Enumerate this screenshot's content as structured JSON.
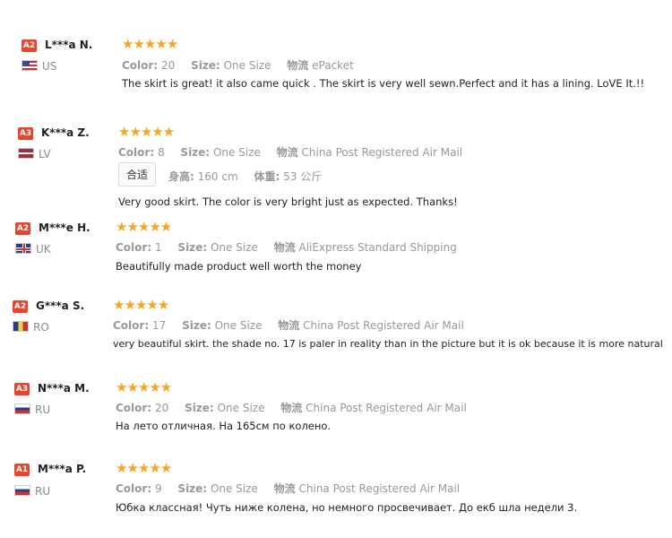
{
  "reviews": [
    {
      "level": "A2",
      "level_color": "#e8452c",
      "name": "L***a N.",
      "country": "US",
      "flag": "us-flag-icon",
      "stars": "★★★★★",
      "color_label": "Color:",
      "color_value": "20",
      "size_label": "Size:",
      "size_value": "One Size",
      "ship_label": "物流",
      "ship_value": "ePacket",
      "text": "The skirt is great! it also came quick . The skirt is very well sewn.Perfect and it has a lining. LoVE It.!!"
    },
    {
      "level": "A3",
      "level_color": "#e8452c",
      "name": "K***a Z.",
      "country": "LV",
      "flag": "lv-flag-icon",
      "stars": "★★★★★",
      "color_label": "Color:",
      "color_value": "8",
      "size_label": "Size:",
      "size_value": "One Size",
      "ship_label": "物流",
      "ship_value": "China Post Registered Air Mail",
      "fit_tag": "合适",
      "height_label": "身高:",
      "height_value": "160 cm",
      "weight_label": "体重:",
      "weight_value": "53 公斤",
      "text": "Very good skirt. The color is very bright just as expected. Thanks!"
    },
    {
      "level": "A2",
      "level_color": "#e8452c",
      "name": "M***e H.",
      "country": "UK",
      "flag": "uk-flag-icon",
      "stars": "★★★★★",
      "color_label": "Color:",
      "color_value": "1",
      "size_label": "Size:",
      "size_value": "One Size",
      "ship_label": "物流",
      "ship_value": "AliExpress Standard Shipping",
      "text": "Beautifully made product well worth the money"
    },
    {
      "level": "A2",
      "level_color": "#e8452c",
      "name": "G***a S.",
      "country": "RO",
      "flag": "ro-flag-icon",
      "stars": "★★★★★",
      "color_label": "Color:",
      "color_value": "17",
      "size_label": "Size:",
      "size_value": "One Size",
      "ship_label": "物流",
      "ship_value": "China Post Registered Air Mail",
      "text": "very beautiful skirt. the shade no. 17 is paler in reality than in the picture but it is ok because it is more natural"
    },
    {
      "level": "A3",
      "level_color": "#e8452c",
      "name": "N***a M.",
      "country": "RU",
      "flag": "ru-flag-icon",
      "stars": "★★★★★",
      "color_label": "Color:",
      "color_value": "20",
      "size_label": "Size:",
      "size_value": "One Size",
      "ship_label": "物流",
      "ship_value": "China Post Registered Air Mail",
      "text": "На лето отличная. На 165см по колено."
    },
    {
      "level": "A1",
      "level_color": "#e8452c",
      "name": "M***a P.",
      "country": "RU",
      "flag": "ru-flag-icon",
      "stars": "★★★★★",
      "color_label": "Color:",
      "color_value": "9",
      "size_label": "Size:",
      "size_value": "One Size",
      "ship_label": "物流",
      "ship_value": "China Post Registered Air Mail",
      "text": "Юбка классная! Чуть ниже колена, но немного просвечивает. До екб шла недели 3."
    }
  ]
}
